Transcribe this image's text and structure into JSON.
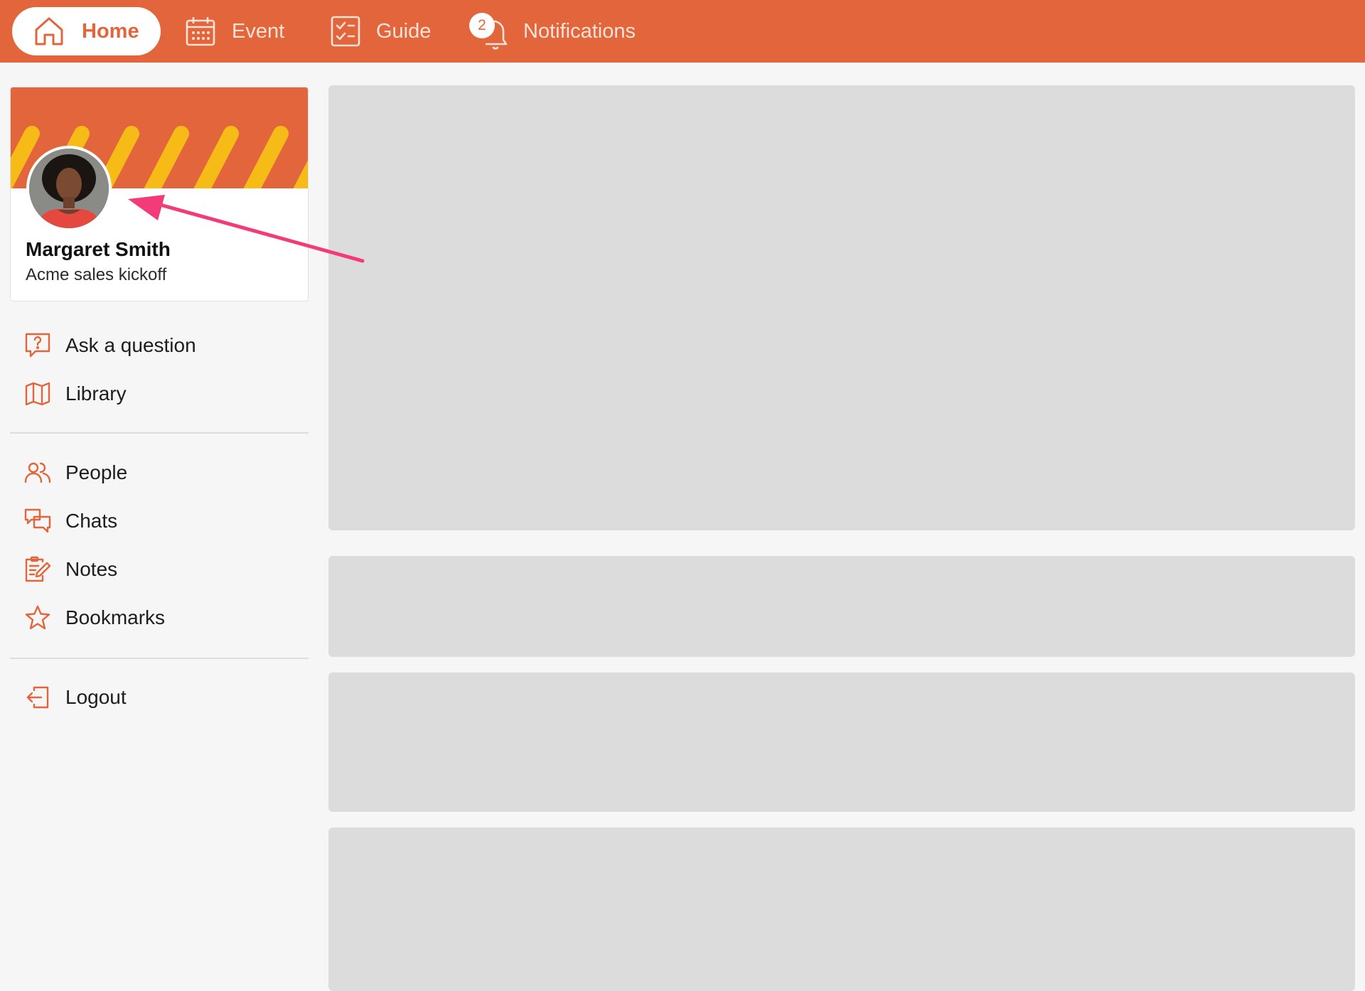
{
  "colors": {
    "brand": "#e2653c",
    "accent_stripe": "#f7bb17",
    "placeholder": "#dcdcdc",
    "annotation_arrow": "#f23b78"
  },
  "topnav": {
    "tabs": [
      {
        "label": "Home",
        "icon": "home-icon",
        "active": true
      },
      {
        "label": "Event",
        "icon": "calendar-icon",
        "active": false
      },
      {
        "label": "Guide",
        "icon": "checklist-icon",
        "active": false
      },
      {
        "label": "Notifications",
        "icon": "bell-icon",
        "active": false,
        "badge": "2"
      }
    ]
  },
  "profile": {
    "name": "Margaret Smith",
    "event": "Acme sales kickoff",
    "avatar_icon": "user-avatar"
  },
  "sidebar": {
    "groups": [
      [
        {
          "label": "Ask a question",
          "icon": "question-bubble-icon"
        },
        {
          "label": "Library",
          "icon": "map-book-icon"
        }
      ],
      [
        {
          "label": "People",
          "icon": "people-icon"
        },
        {
          "label": "Chats",
          "icon": "chat-bubbles-icon"
        },
        {
          "label": "Notes",
          "icon": "notes-icon"
        },
        {
          "label": "Bookmarks",
          "icon": "star-icon"
        }
      ],
      [
        {
          "label": "Logout",
          "icon": "logout-icon"
        }
      ]
    ]
  }
}
